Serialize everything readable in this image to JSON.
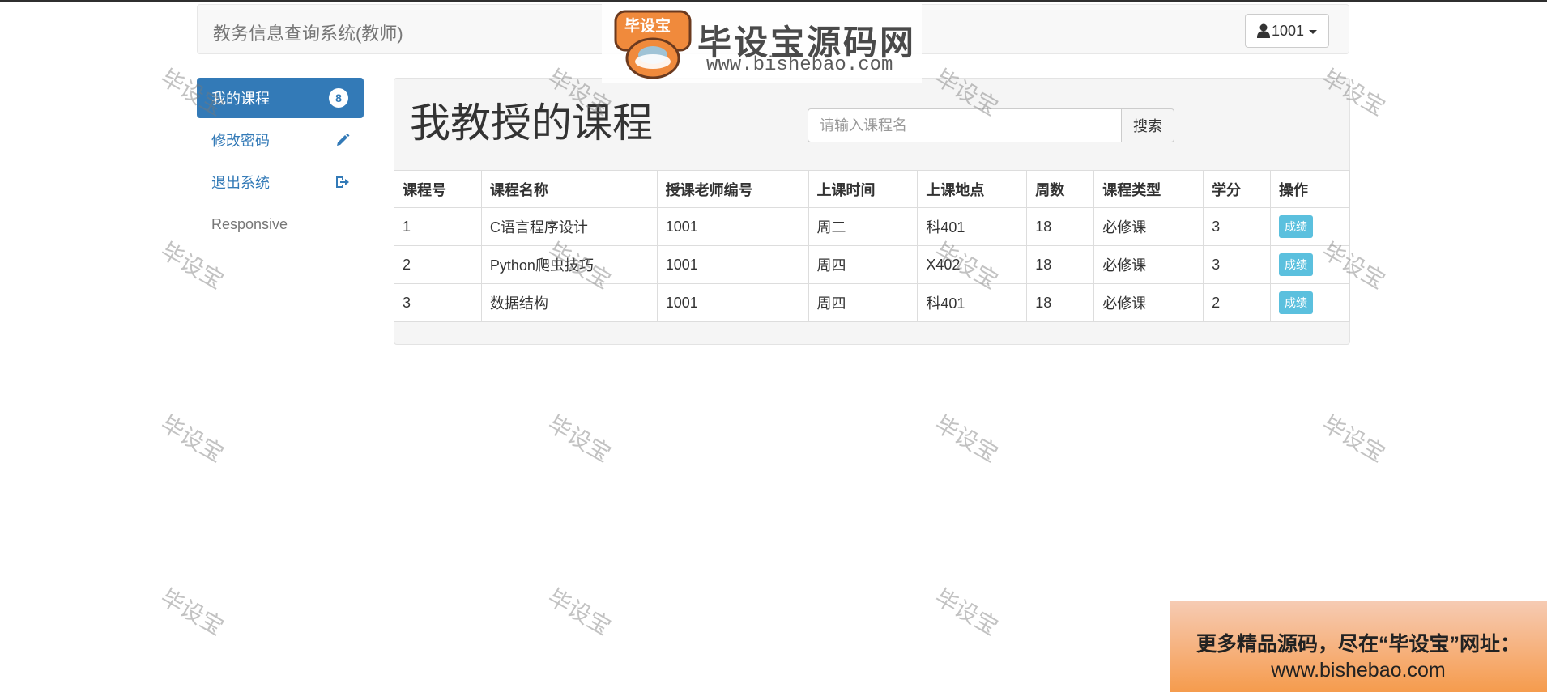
{
  "navbar": {
    "brand": "教务信息查询系统(教师)",
    "user_label": "1001"
  },
  "sidebar": {
    "items": [
      {
        "label": "我的课程",
        "badge": "8"
      },
      {
        "label": "修改密码",
        "icon": "pencil-icon"
      },
      {
        "label": "退出系统",
        "icon": "logout-icon"
      },
      {
        "label": "Responsive"
      }
    ]
  },
  "main": {
    "title": "我教授的课程",
    "search": {
      "placeholder": "请输入课程名",
      "button_label": "搜索"
    },
    "table": {
      "headers": [
        "课程号",
        "课程名称",
        "授课老师编号",
        "上课时间",
        "上课地点",
        "周数",
        "课程类型",
        "学分",
        "操作"
      ],
      "rows": [
        {
          "id": "1",
          "name": "C语言程序设计",
          "teacher": "1001",
          "time": "周二",
          "place": "科401",
          "weeks": "18",
          "type": "必修课",
          "credit": "3",
          "action": "成绩"
        },
        {
          "id": "2",
          "name": "Python爬虫技巧",
          "teacher": "1001",
          "time": "周四",
          "place": "X402",
          "weeks": "18",
          "type": "必修课",
          "credit": "3",
          "action": "成绩"
        },
        {
          "id": "3",
          "name": "数据结构",
          "teacher": "1001",
          "time": "周四",
          "place": "科401",
          "weeks": "18",
          "type": "必修课",
          "credit": "2",
          "action": "成绩"
        }
      ]
    }
  },
  "watermark": {
    "text": "毕设宝",
    "logo_badge": "毕设宝",
    "logo_title": "毕设宝源码网",
    "logo_url": "www.bishebao.com",
    "banner_line1": "更多精品源码，尽在“毕设宝”网址：",
    "banner_line2": "www.bishebao.com"
  },
  "colors": {
    "primary": "#337ab7",
    "info": "#5bc0de",
    "logo_orange": "#f08a3c"
  }
}
